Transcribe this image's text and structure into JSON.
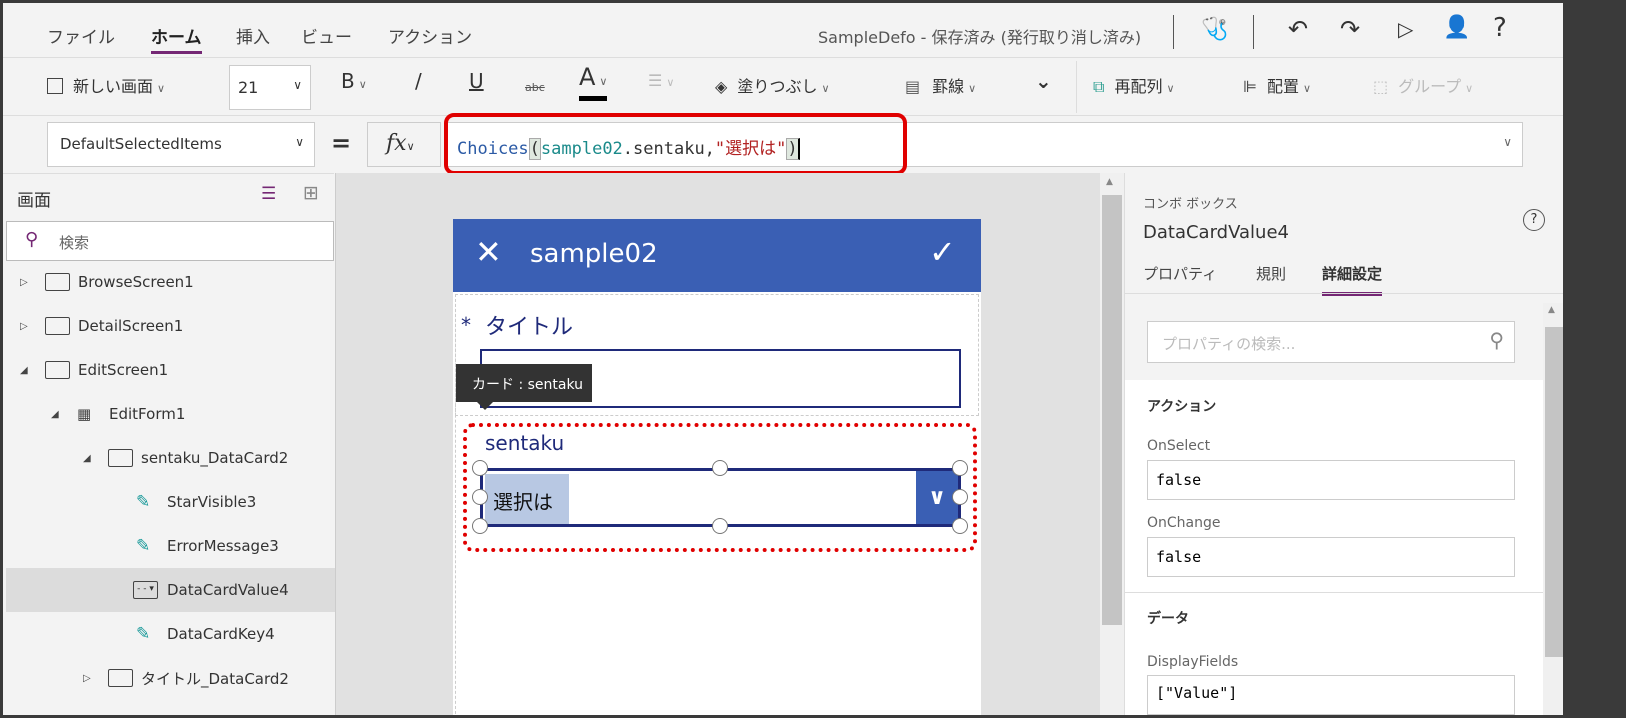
{
  "menu": {
    "tabs": [
      "ファイル",
      "ホーム",
      "挿入",
      "ビュー",
      "アクション"
    ],
    "active": "ホーム",
    "doc_title": "SampleDefo - 保存済み (発行取り消し済み)"
  },
  "icons": {
    "checker": "stethoscope-icon",
    "undo": "undo-icon",
    "redo": "redo-icon",
    "play": "play-icon",
    "share": "add-user-icon",
    "help": "help-icon"
  },
  "toolbar": {
    "new_screen": "新しい画面",
    "font_size": "21",
    "bold": "B",
    "italic": "/",
    "underline": "U",
    "strike": "abc",
    "font_color": "A",
    "fill": "塗りつぶし",
    "border": "罫線",
    "reorder": "再配列",
    "align": "配置",
    "group": "グループ"
  },
  "formula": {
    "property": "DefaultSelectedItems",
    "equals": "=",
    "fx": "fx",
    "parts": {
      "fn": "Choices",
      "open": "(",
      "ds": "sample02",
      "field": ".sentaku,",
      "str": "\"選択は\"",
      "close": ")"
    }
  },
  "tree": {
    "title": "画面",
    "search_placeholder": "検索",
    "items": [
      "BrowseScreen1",
      "DetailScreen1",
      "EditScreen1",
      "EditForm1",
      "sentaku_DataCard2",
      "StarVisible3",
      "ErrorMessage3",
      "DataCardValue4",
      "DataCardKey4",
      "タイトル_DataCard2"
    ]
  },
  "canvas": {
    "header_title": "sample02",
    "title_required": "*",
    "title_label": "タイトル",
    "tooltip": "カード : sentaku",
    "sentaku_label": "sentaku",
    "selected_item": "選択は"
  },
  "panel": {
    "type": "コンボ ボックス",
    "name": "DataCardValue4",
    "tabs": [
      "プロパティ",
      "規則",
      "詳細設定"
    ],
    "active_tab": "詳細設定",
    "search_placeholder": "プロパティの検索...",
    "section_action": "アクション",
    "onselect_label": "OnSelect",
    "onselect_value": "false",
    "onchange_label": "OnChange",
    "onchange_value": "false",
    "section_data": "データ",
    "displayfields_label": "DisplayFields",
    "displayfields_value": "[\"Value\"]"
  },
  "colors": {
    "accent": "#742774",
    "brand_blue": "#3a5fb4",
    "highlight": "#e00000"
  }
}
